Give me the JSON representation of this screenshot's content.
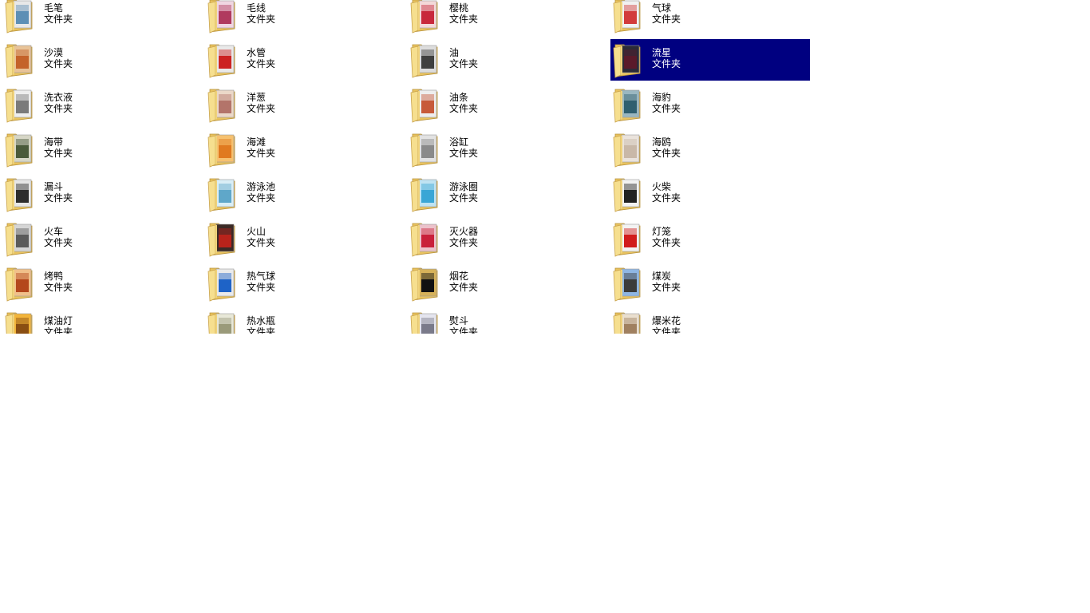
{
  "folder_type_label": "文件夹",
  "selected_index": 7,
  "items": [
    {
      "name": "毛笔",
      "type": "文件夹",
      "thumb": [
        "#5d8fb5",
        "#e8e8e8"
      ]
    },
    {
      "name": "毛线",
      "type": "文件夹",
      "thumb": [
        "#b03a5e",
        "#f0d6e2"
      ]
    },
    {
      "name": "樱桃",
      "type": "文件夹",
      "thumb": [
        "#c8283c",
        "#f3d9d9"
      ]
    },
    {
      "name": "气球",
      "type": "文件夹",
      "thumb": [
        "#d23b3b",
        "#f1f1f1"
      ]
    },
    {
      "name": "沙漠",
      "type": "文件夹",
      "thumb": [
        "#c4632a",
        "#e8c398"
      ]
    },
    {
      "name": "水管",
      "type": "文件夹",
      "thumb": [
        "#cc2222",
        "#e9e9e9"
      ]
    },
    {
      "name": "油",
      "type": "文件夹",
      "thumb": [
        "#3f3f3f",
        "#dcdcdc"
      ]
    },
    {
      "name": "流星",
      "type": "文件夹",
      "thumb": [
        "#5a1a2a",
        "#2b2b38"
      ]
    },
    {
      "name": "洗衣液",
      "type": "文件夹",
      "thumb": [
        "#7a7a7a",
        "#eeeeee"
      ]
    },
    {
      "name": "洋葱",
      "type": "文件夹",
      "thumb": [
        "#b3746a",
        "#ebd8c8"
      ]
    },
    {
      "name": "油条",
      "type": "文件夹",
      "thumb": [
        "#c75a3a",
        "#eeeeee"
      ]
    },
    {
      "name": "海豹",
      "type": "文件夹",
      "thumb": [
        "#2f5f6f",
        "#9ab7c0"
      ]
    },
    {
      "name": "海带",
      "type": "文件夹",
      "thumb": [
        "#4a5a3a",
        "#d6d6c6"
      ]
    },
    {
      "name": "海滩",
      "type": "文件夹",
      "thumb": [
        "#e07a20",
        "#f6c170"
      ]
    },
    {
      "name": "浴缸",
      "type": "文件夹",
      "thumb": [
        "#8a8a8a",
        "#e2e2e2"
      ]
    },
    {
      "name": "海鸥",
      "type": "文件夹",
      "thumb": [
        "#c9b8a8",
        "#eae3dc"
      ]
    },
    {
      "name": "漏斗",
      "type": "文件夹",
      "thumb": [
        "#2c2c2c",
        "#e6e6e6"
      ]
    },
    {
      "name": "游泳池",
      "type": "文件夹",
      "thumb": [
        "#5fa7c9",
        "#d9eef6"
      ]
    },
    {
      "name": "游泳圈",
      "type": "文件夹",
      "thumb": [
        "#3aa6d6",
        "#bfe3f2"
      ]
    },
    {
      "name": "火柴",
      "type": "文件夹",
      "thumb": [
        "#222222",
        "#f2f2f2"
      ]
    },
    {
      "name": "火车",
      "type": "文件夹",
      "thumb": [
        "#5b5b5b",
        "#d5d5d5"
      ]
    },
    {
      "name": "火山",
      "type": "文件夹",
      "thumb": [
        "#b8231b",
        "#3b2a26"
      ]
    },
    {
      "name": "灭火器",
      "type": "文件夹",
      "thumb": [
        "#c9203b",
        "#ecc2cb"
      ]
    },
    {
      "name": "灯笼",
      "type": "文件夹",
      "thumb": [
        "#d11c1c",
        "#f3f3f3"
      ]
    },
    {
      "name": "烤鸭",
      "type": "文件夹",
      "thumb": [
        "#b4471c",
        "#f0c08a"
      ]
    },
    {
      "name": "热气球",
      "type": "文件夹",
      "thumb": [
        "#1e63c7",
        "#eaeaea"
      ]
    },
    {
      "name": "烟花",
      "type": "文件夹",
      "thumb": [
        "#111111",
        "#d6b25a"
      ]
    },
    {
      "name": "煤炭",
      "type": "文件夹",
      "thumb": [
        "#3b3b3b",
        "#8fb6e3"
      ]
    },
    {
      "name": "煤油灯",
      "type": "文件夹",
      "thumb": [
        "#8a4e12",
        "#f2b43a"
      ]
    },
    {
      "name": "热水瓶",
      "type": "文件夹",
      "thumb": [
        "#9a9a7a",
        "#e8e8d8"
      ]
    },
    {
      "name": "熨斗",
      "type": "文件夹",
      "thumb": [
        "#7a7a8a",
        "#e5e5ee"
      ]
    },
    {
      "name": "爆米花",
      "type": "文件夹",
      "thumb": [
        "#a08060",
        "#eadfcf"
      ]
    }
  ]
}
